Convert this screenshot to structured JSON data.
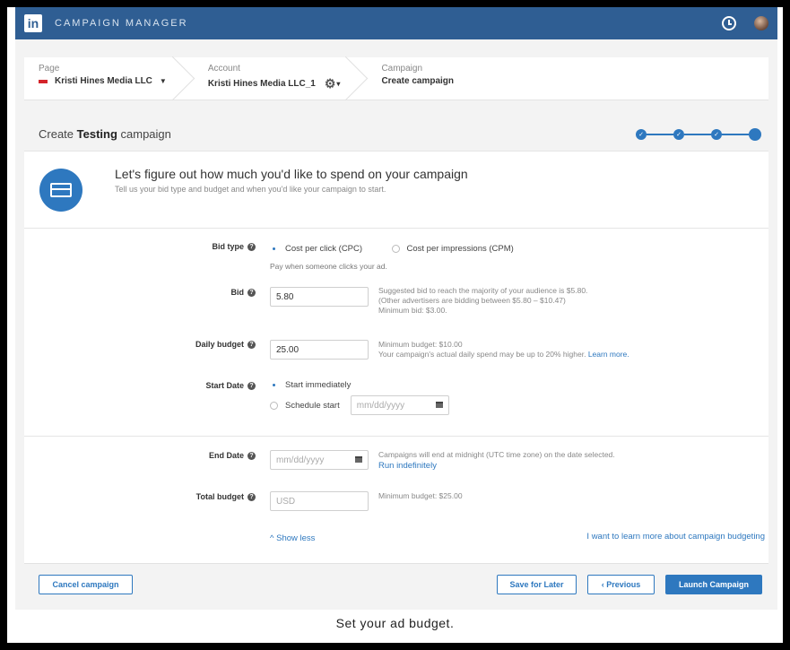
{
  "topbar": {
    "logo": "in",
    "title": "CAMPAIGN MANAGER",
    "icons": [
      "clock-icon",
      "avatar"
    ]
  },
  "breadcrumb": [
    {
      "label": "Page",
      "value": "Kristi Hines Media LLC"
    },
    {
      "label": "Account",
      "value": "Kristi Hines Media LLC_1"
    },
    {
      "label": "Campaign",
      "value": "Create campaign"
    }
  ],
  "header": {
    "title_prefix": "Create ",
    "title_bold": "Testing",
    "title_suffix": " campaign",
    "steps_total": 4,
    "steps_done": 3
  },
  "intro": {
    "heading": "Let's figure out how much you'd like to spend on your campaign",
    "sub": "Tell us your bid type and budget and when you'd like your campaign to start."
  },
  "form": {
    "bid_type": {
      "label": "Bid type",
      "option_cpc": "Cost per click (CPC)",
      "option_cpm": "Cost per impressions (CPM)",
      "selected": "cpc",
      "note": "Pay when someone clicks your ad."
    },
    "bid": {
      "label": "Bid",
      "value": "5.80",
      "note1": "Suggested bid to reach the majority of your audience is $5.80.",
      "note2": "(Other advertisers are bidding between $5.80 – $10.47)",
      "note3": "Minimum bid: $3.00."
    },
    "daily_budget": {
      "label": "Daily budget",
      "value": "25.00",
      "note1": "Minimum budget: $10.00",
      "note2": "Your campaign's actual daily spend may be up to 20% higher.",
      "learn_more": "Learn more."
    },
    "start_date": {
      "label": "Start Date",
      "option_now": "Start immediately",
      "option_schedule": "Schedule start",
      "placeholder": "mm/dd/yyyy"
    },
    "end_date": {
      "label": "End Date",
      "placeholder": "mm/dd/yyyy",
      "note": "Campaigns will end at midnight (UTC time zone) on the date selected.",
      "run_link": "Run indefinitely"
    },
    "total_budget": {
      "label": "Total budget",
      "placeholder": "USD",
      "note": "Minimum budget: $25.00"
    },
    "show_less": "Show less",
    "learn_budget": "I want to learn more about campaign budgeting"
  },
  "footer": {
    "cancel": "Cancel campaign",
    "save": "Save for Later",
    "previous": "‹ Previous",
    "launch": "Launch Campaign"
  },
  "caption": "Set your ad budget.",
  "colors": {
    "brand": "#2f5e93",
    "accent": "#2e78bf"
  }
}
